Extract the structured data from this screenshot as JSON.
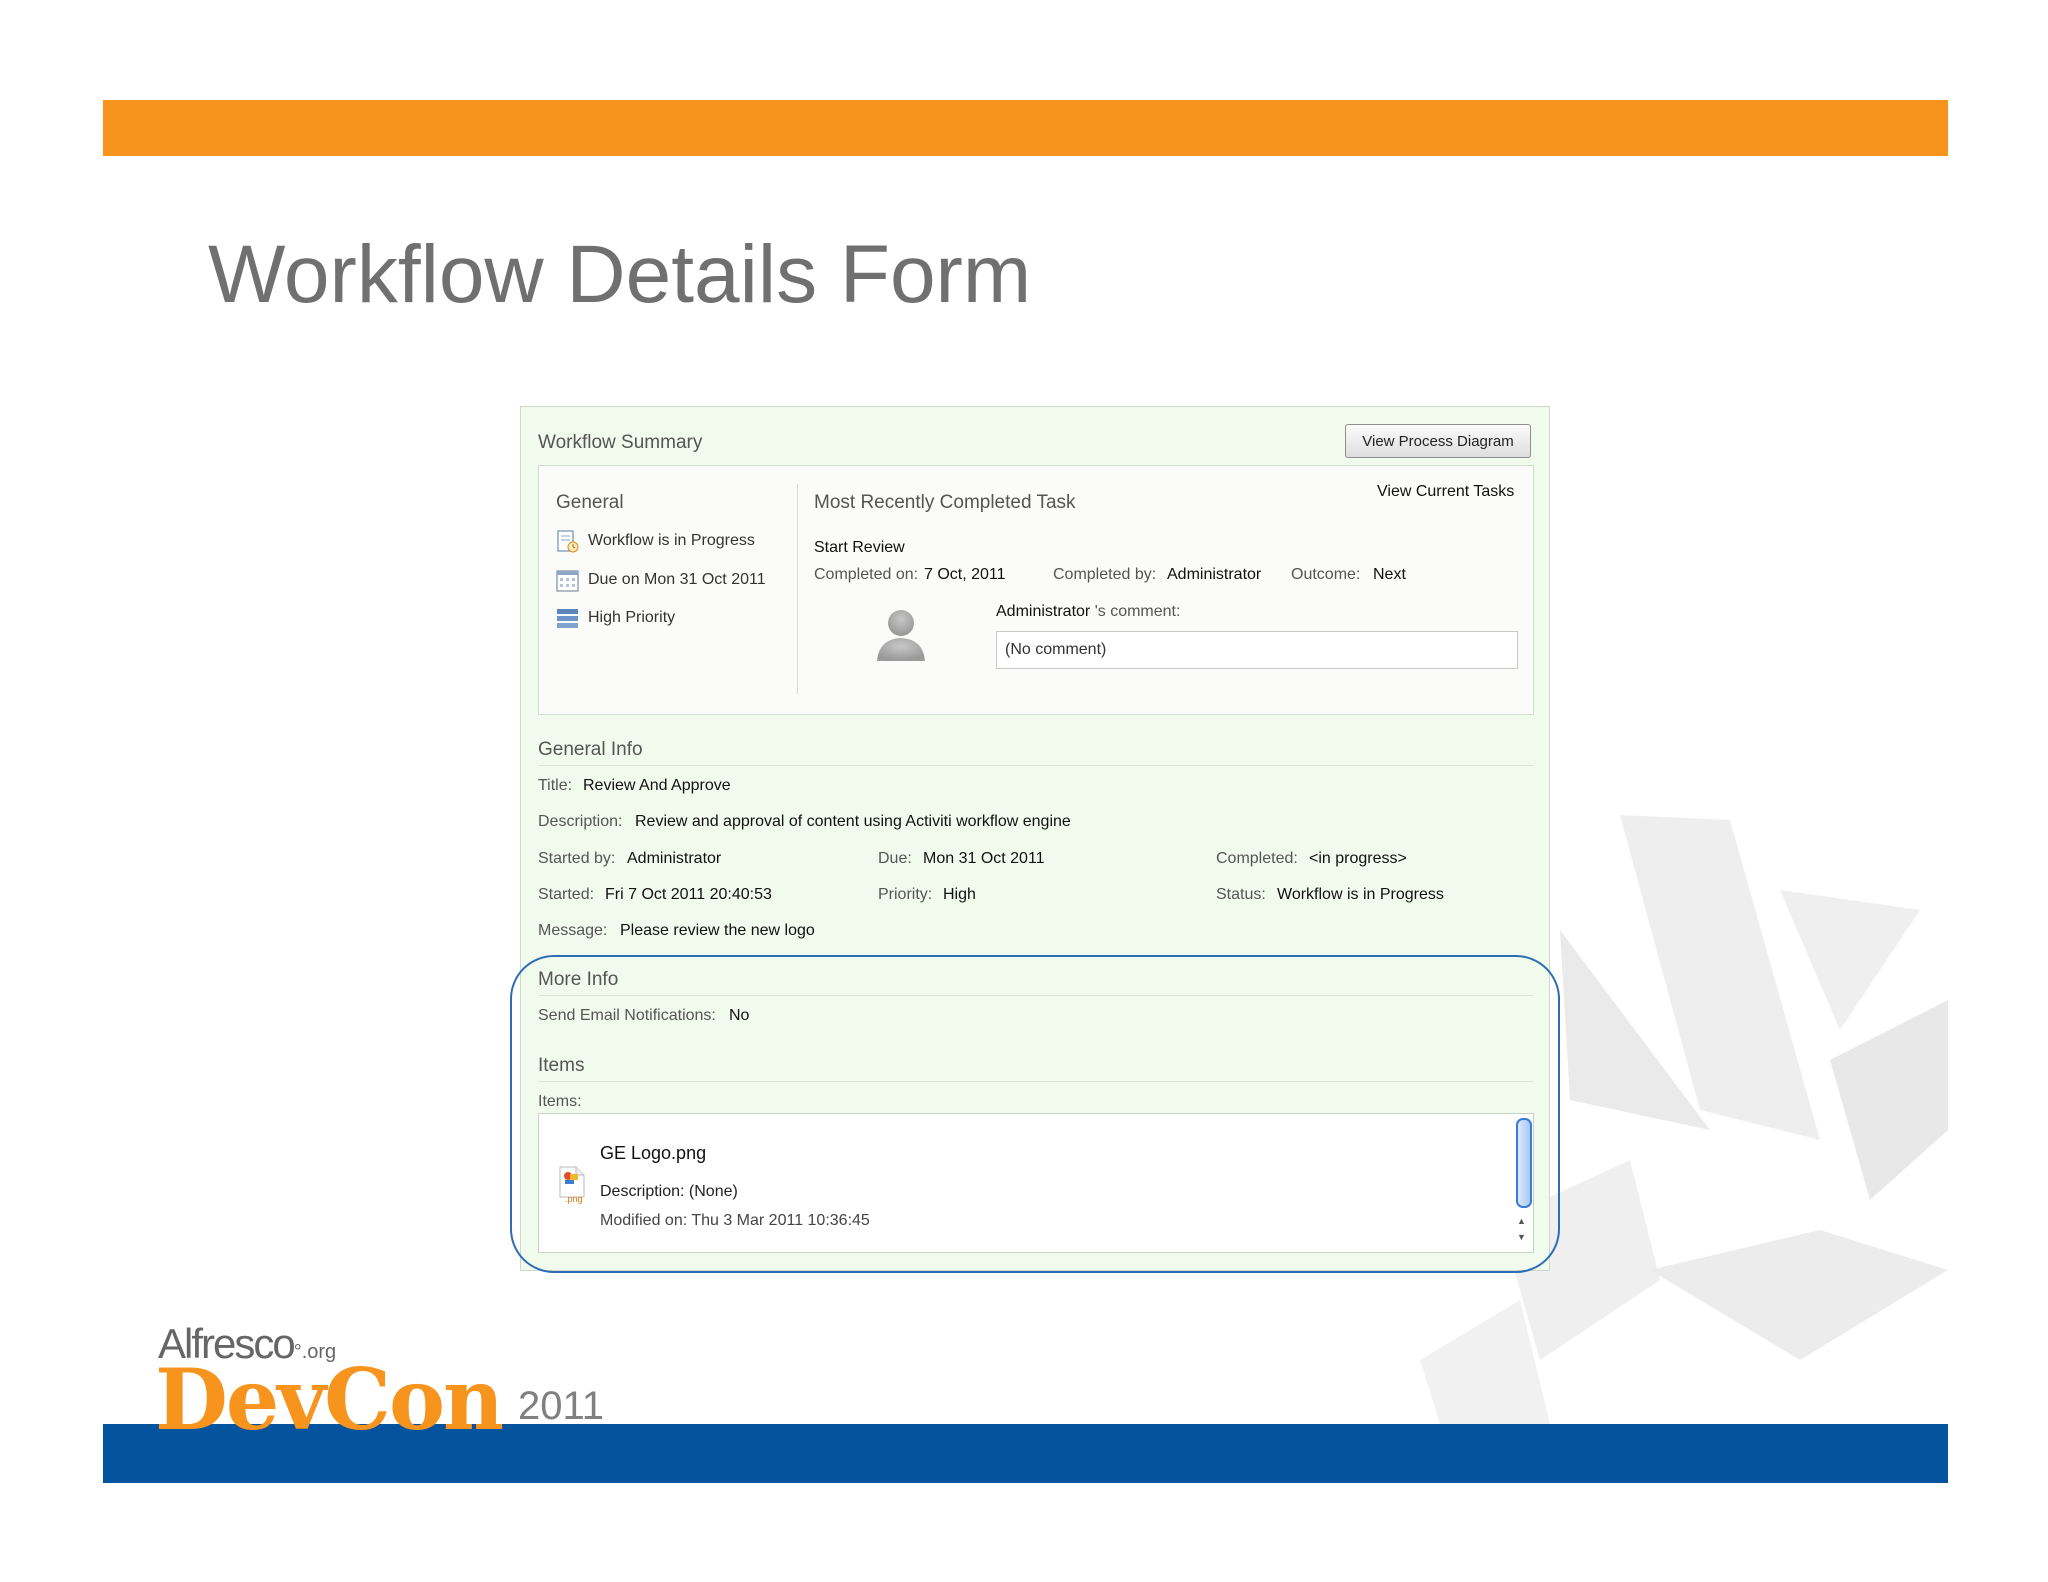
{
  "slide": {
    "title": "Workflow Details Form"
  },
  "workflow_summary": {
    "title": "Workflow Summary",
    "view_process_diagram": "View Process Diagram",
    "general": {
      "title": "General",
      "items": [
        {
          "icon": "workflow-status-icon",
          "label": "Workflow is in Progress"
        },
        {
          "icon": "calendar-icon",
          "label": "Due on Mon 31 Oct 2011"
        },
        {
          "icon": "priority-icon",
          "label": "High Priority"
        }
      ]
    },
    "recent_task": {
      "title": "Most Recently Completed Task",
      "view_current_tasks": "View Current Tasks",
      "task_name": "Start Review",
      "completed_on_label": "Completed on:",
      "completed_on_value": "7 Oct, 2011",
      "completed_by_label": "Completed by:",
      "completed_by_value": "Administrator",
      "outcome_label": "Outcome:",
      "outcome_value": "Next",
      "comment_author": "Administrator",
      "comment_suffix": " 's comment:",
      "comment_text": "(No comment)"
    }
  },
  "general_info": {
    "title": "General Info",
    "title_label": "Title:",
    "title_value": "Review And Approve",
    "description_label": "Description:",
    "description_value": "Review and approval of content using Activiti workflow engine",
    "started_by_label": "Started by:",
    "started_by_value": "Administrator",
    "due_label": "Due:",
    "due_value": "Mon 31 Oct 2011",
    "completed_label": "Completed:",
    "completed_value": "<in progress>",
    "started_label": "Started:",
    "started_value": "Fri 7 Oct 2011 20:40:53",
    "priority_label": "Priority:",
    "priority_value": "High",
    "status_label": "Status:",
    "status_value": "Workflow is in Progress",
    "message_label": "Message:",
    "message_value": "Please review the new logo"
  },
  "more_info": {
    "title": "More Info",
    "email_label": "Send Email Notifications:",
    "email_value": "No"
  },
  "items": {
    "title": "Items",
    "label": "Items:",
    "list": [
      {
        "name": "GE Logo.png",
        "icon_tag": ".png",
        "description": "Description: (None)",
        "modified": "Modified on: Thu 3 Mar 2011 10:36:45"
      }
    ]
  },
  "logo": {
    "alfresco": "Alfresco",
    "org": "°.org",
    "devcon": "DevCon",
    "year": "2011"
  },
  "colors": {
    "orange": "#f7941d",
    "blue": "#04539e",
    "panel_bg": "#f1fbed",
    "highlight": "#2f6db3"
  }
}
